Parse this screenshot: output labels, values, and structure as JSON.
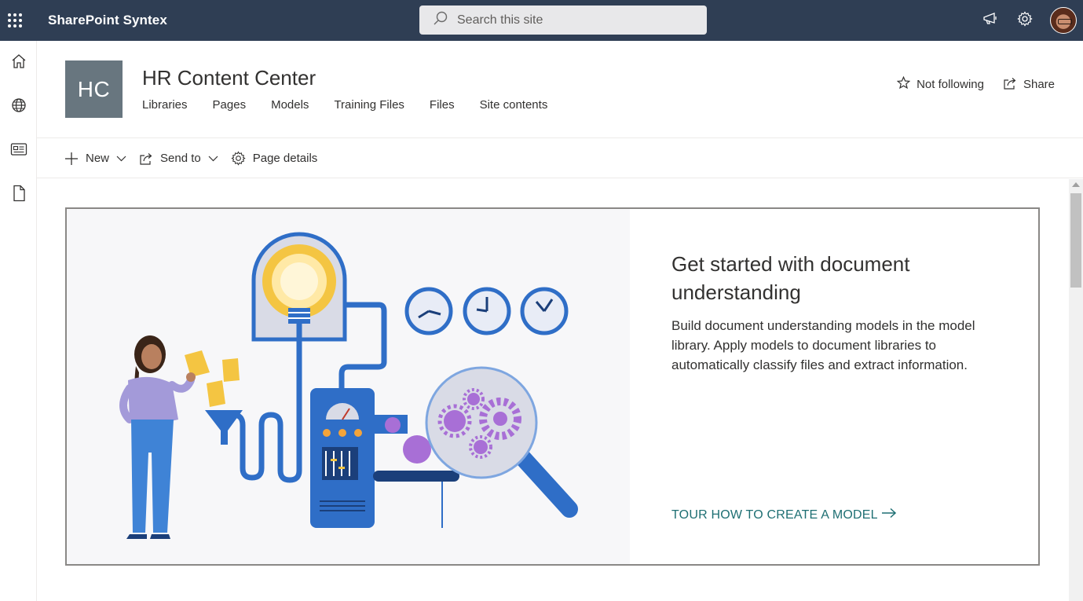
{
  "suitebar": {
    "app_title": "SharePoint Syntex",
    "search_placeholder": "Search this site",
    "icons": [
      "waffle-icon",
      "search-icon",
      "megaphone-icon",
      "gear-icon",
      "avatar"
    ]
  },
  "leftrail": {
    "items": [
      {
        "name": "home",
        "icon": "home-icon"
      },
      {
        "name": "sites",
        "icon": "globe-icon"
      },
      {
        "name": "news",
        "icon": "news-icon"
      },
      {
        "name": "files",
        "icon": "document-icon"
      }
    ]
  },
  "site": {
    "logo_text": "HC",
    "title": "HR Content Center",
    "nav": [
      "Libraries",
      "Pages",
      "Models",
      "Training Files",
      "Files",
      "Site contents"
    ],
    "follow_label": "Not following",
    "share_label": "Share"
  },
  "commandbar": {
    "new_label": "New",
    "send_to_label": "Send to",
    "page_details_label": "Page details"
  },
  "card": {
    "title": "Get started with document understanding",
    "description": "Build document understanding models in the model library. Apply models to document libraries to automatically classify files and extract information.",
    "cta_label": "TOUR HOW TO CREATE A MODEL"
  },
  "colors": {
    "suitebar_bg": "#2f3e54",
    "site_logo_bg": "#68767f",
    "cta_color": "#1e6f73",
    "illustration_blue": "#2f6ec7",
    "illustration_yellow": "#f4c542",
    "illustration_purple": "#a86fd6"
  }
}
